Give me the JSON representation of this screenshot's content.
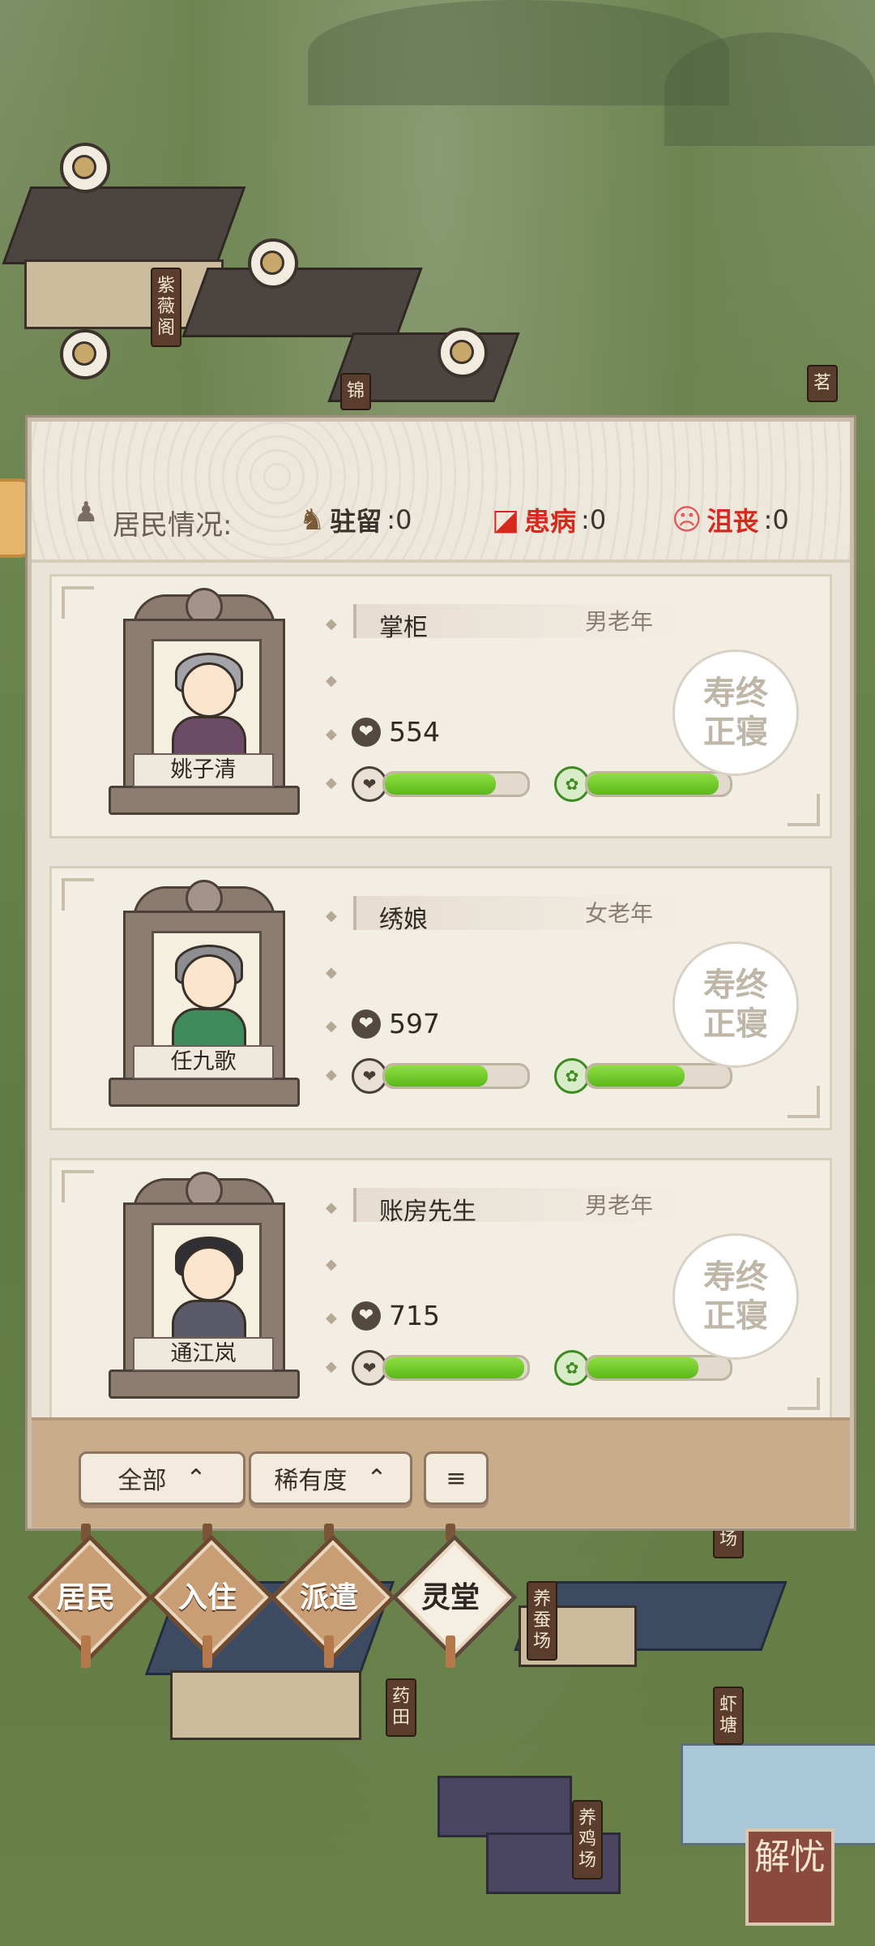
{
  "map": {
    "signs": [
      "紫薇阁",
      "锦",
      "茗",
      "鸡场",
      "养蚕场",
      "药田",
      "虾塘",
      "养鸡场"
    ],
    "corner_button": "解忧"
  },
  "header": {
    "residents_label": "居民情况:",
    "stats": [
      {
        "icon": "horse-icon",
        "label": "驻留",
        "value": ":0",
        "color": "#3a332e"
      },
      {
        "icon": "pill-icon",
        "label": "患病",
        "value": ":0",
        "color": "#d8281e"
      },
      {
        "icon": "sad-face-icon",
        "label": "沮丧",
        "value": ":0",
        "color": "#d8281e"
      }
    ]
  },
  "residents": [
    {
      "name": "姚子清",
      "job": "掌柜",
      "age_group": "男老年",
      "score": "554",
      "health": 0.78,
      "mood": 0.92,
      "stamp": "寿终正寝"
    },
    {
      "name": "任九歌",
      "job": "绣娘",
      "age_group": "女老年",
      "score": "597",
      "health": 0.72,
      "mood": 0.68,
      "stamp": "寿终正寝"
    },
    {
      "name": "通江岚",
      "job": "账房先生",
      "age_group": "男老年",
      "score": "715",
      "health": 0.98,
      "mood": 0.78,
      "stamp": "寿终正寝"
    }
  ],
  "filters": {
    "all_label": "全部",
    "rarity_label": "稀有度",
    "sort_icon": "sort-icon"
  },
  "nav": [
    {
      "label": "居民",
      "active": false
    },
    {
      "label": "入住",
      "active": false
    },
    {
      "label": "派遣",
      "active": false
    },
    {
      "label": "灵堂",
      "active": true
    }
  ]
}
